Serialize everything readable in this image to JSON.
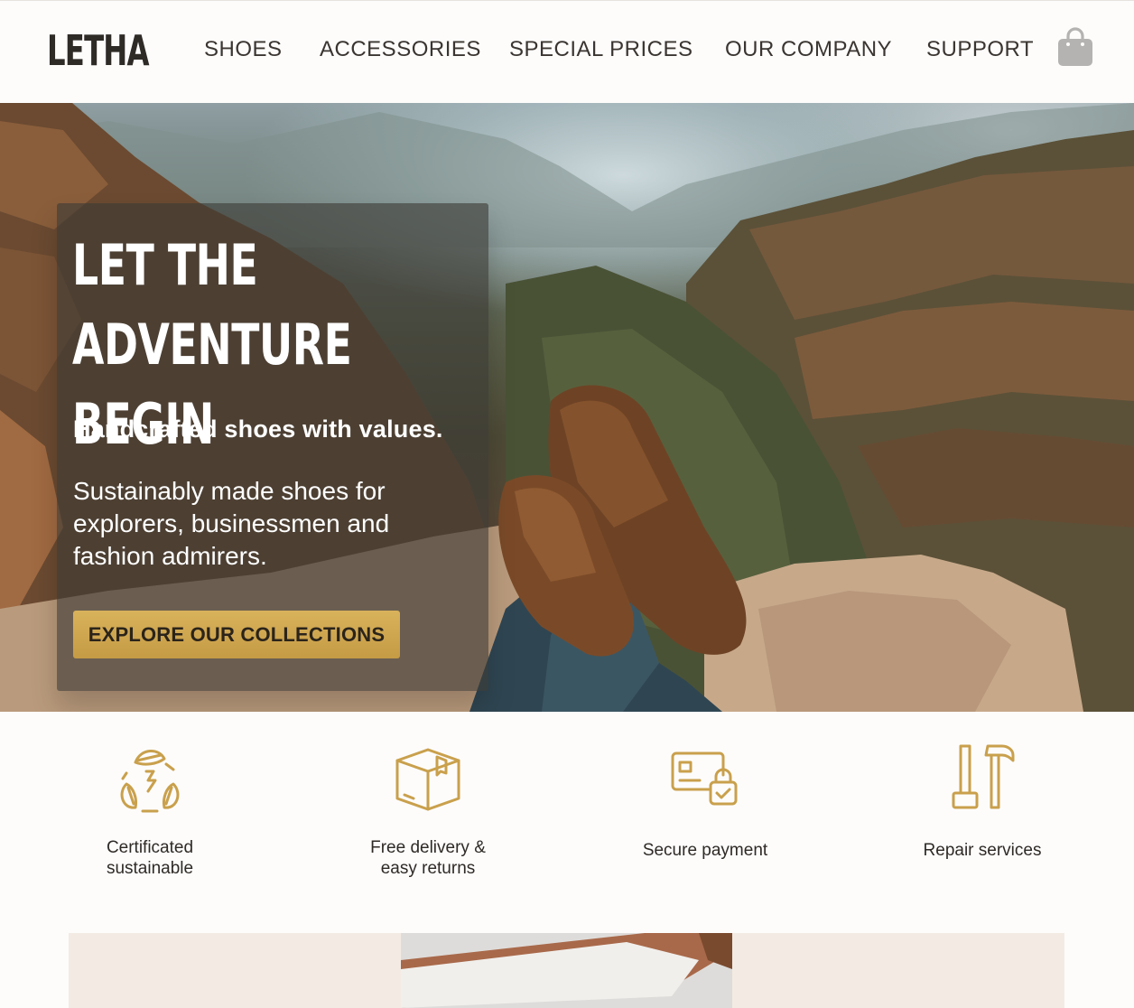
{
  "brand": {
    "logo": "LETHA",
    "accent_color": "#c9a04c"
  },
  "nav": {
    "items": [
      {
        "label": "SHOES"
      },
      {
        "label": "ACCESSORIES"
      },
      {
        "label": "SPECIAL PRICES"
      },
      {
        "label": "OUR COMPANY"
      },
      {
        "label": "SUPPORT"
      }
    ],
    "cart_icon": "shopping-bag-icon"
  },
  "hero": {
    "title_line1": "LET THE ADVENTURE",
    "title_line2": "BEGIN",
    "subtitle": "Handcrafted shoes with values.",
    "description": "Sustainably made shoes for explorers, businessmen and fashion admirers.",
    "cta_label": "EXPLORE OUR COLLECTIONS"
  },
  "features": [
    {
      "icon": "recycle-leaf-icon",
      "label": "Certificated sustainable"
    },
    {
      "icon": "package-box-icon",
      "label": "Free delivery & easy returns"
    },
    {
      "icon": "secure-card-icon",
      "label": "Secure payment"
    },
    {
      "icon": "repair-tools-icon",
      "label": "Repair services"
    }
  ]
}
